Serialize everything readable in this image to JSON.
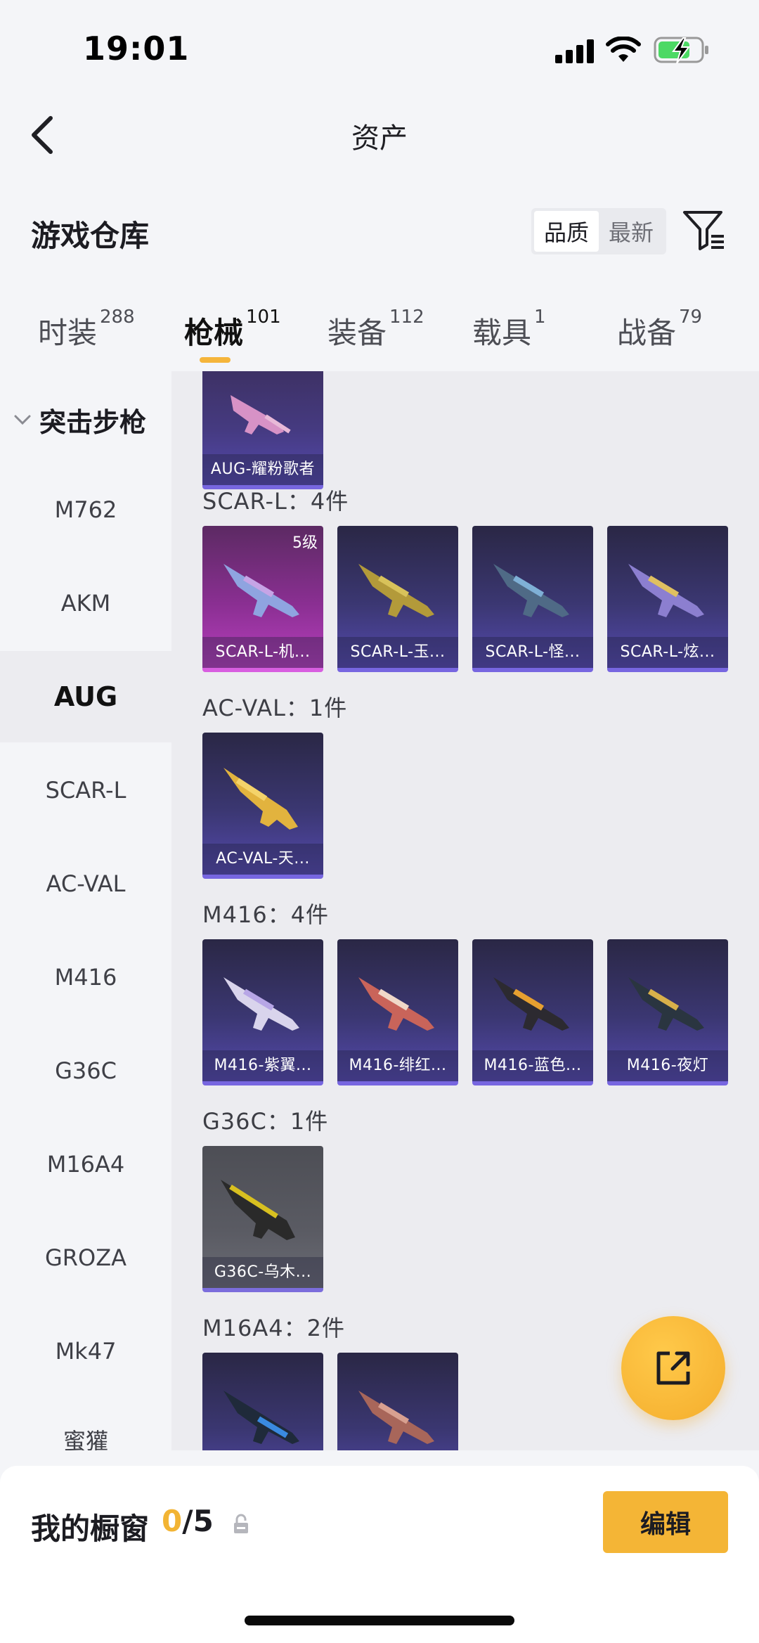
{
  "status_bar": {
    "time": "19:01"
  },
  "header": {
    "title": "资产"
  },
  "section": {
    "title": "游戏仓库",
    "sort_options": [
      "品质",
      "最新"
    ],
    "sort_active": "品质"
  },
  "tabs": [
    {
      "label": "时装",
      "count": "288"
    },
    {
      "label": "枪械",
      "count": "101",
      "active": true
    },
    {
      "label": "装备",
      "count": "112"
    },
    {
      "label": "载具",
      "count": "1"
    },
    {
      "label": "战备",
      "count": "79"
    }
  ],
  "sidebar": {
    "category": "突击步枪",
    "items": [
      "M762",
      "AKM",
      "AUG",
      "SCAR-L",
      "AC-VAL",
      "M416",
      "G36C",
      "M16A4",
      "GROZA",
      "Mk47",
      "蜜獾"
    ],
    "active": "AUG"
  },
  "groups": [
    {
      "label": "",
      "items": [
        {
          "name": "AUG-耀粉歌者"
        }
      ]
    },
    {
      "label": "SCAR-L：4件",
      "items": [
        {
          "name": "SCAR-L-机...",
          "level": "5级"
        },
        {
          "name": "SCAR-L-玉..."
        },
        {
          "name": "SCAR-L-怪..."
        },
        {
          "name": "SCAR-L-炫..."
        }
      ]
    },
    {
      "label": "AC-VAL：1件",
      "items": [
        {
          "name": "AC-VAL-天..."
        }
      ]
    },
    {
      "label": "M416：4件",
      "items": [
        {
          "name": "M416-紫翼..."
        },
        {
          "name": "M416-绯红..."
        },
        {
          "name": "M416-蓝色..."
        },
        {
          "name": "M416-夜灯"
        }
      ]
    },
    {
      "label": "G36C：1件",
      "items": [
        {
          "name": "G36C-乌木..."
        }
      ]
    },
    {
      "label": "M16A4：2件",
      "items": [
        {
          "name": ""
        },
        {
          "name": ""
        }
      ]
    }
  ],
  "bottom_bar": {
    "label": "我的橱窗",
    "current": "0",
    "total": "/5",
    "edit_label": "编辑"
  },
  "colors": {
    "accent": "#f4b536",
    "card_blue": "#3b3772",
    "card_purple": "#8a2f92"
  }
}
